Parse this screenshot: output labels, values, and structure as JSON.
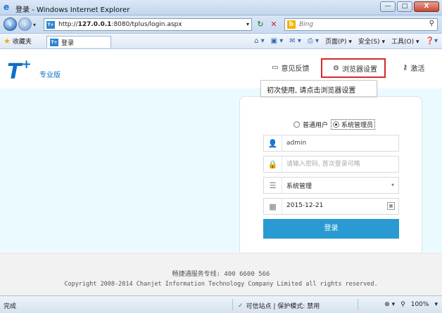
{
  "window": {
    "title": "登录 - Windows Internet Explorer",
    "minimize": "—",
    "maximize": "□",
    "close": "X"
  },
  "address": {
    "url_prefix": "http://",
    "url_host": "127.0.0.1",
    "url_rest": ":8080/tplus/login.aspx",
    "favicon_text": "T+",
    "search_placeholder": "Bing",
    "search_logo": "b"
  },
  "commandbar": {
    "favorites": "收藏夹",
    "tab_title": "登录",
    "page_menu": "页面(P) ▾",
    "safety_menu": "安全(S) ▾",
    "tools_menu": "工具(O) ▾"
  },
  "header": {
    "logo_text": "T",
    "logo_plus": "+",
    "logo_sub": "专业版",
    "feedback": "意见反馈",
    "browser_settings": "浏览器设置",
    "activate": "激活",
    "tooltip": "初次使用, 请点击浏览器设置"
  },
  "login": {
    "radio_normal": "普通用户",
    "radio_admin": "系统管理员",
    "selected_role": "admin",
    "username_value": "admin",
    "password_placeholder": "请输入密码, 首次登录可略",
    "system_value": "系统管理",
    "date_value": "2015-12-21",
    "login_button": "登录"
  },
  "footer": {
    "hotline": "畅捷通服务专线: 400 6600 566",
    "copyright": "Copyright 2008-2014 Chanjet Information Technology Company Limited all rights reserved."
  },
  "status": {
    "done": "完成",
    "zone": "可信站点 | 保护模式: 禁用",
    "zoom": "100%"
  }
}
